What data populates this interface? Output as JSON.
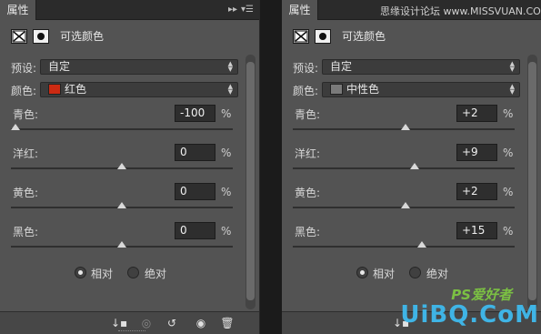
{
  "watermark": "思缘设计论坛 www.MISSVUAN.COM",
  "logo": {
    "line1": "PS爱好者",
    "line2": "UiBQ.CoM"
  },
  "panels": [
    {
      "tab": "属性",
      "title": "可选颜色",
      "preset_label": "预设:",
      "preset_value": "自定",
      "color_label": "颜色:",
      "color_value": "红色",
      "color_swatch": "#cc2a12",
      "sliders": [
        {
          "label": "青色:",
          "value": "-100",
          "unit": "%",
          "position": -100
        },
        {
          "label": "洋红:",
          "value": "0",
          "unit": "%",
          "position": 0
        },
        {
          "label": "黄色:",
          "value": "0",
          "unit": "%",
          "position": 0
        },
        {
          "label": "黑色:",
          "value": "0",
          "unit": "%",
          "position": 0
        }
      ],
      "radio_relative": "相对",
      "radio_absolute": "绝对",
      "selected_mode": "relative"
    },
    {
      "tab": "属性",
      "title": "可选颜色",
      "preset_label": "预设:",
      "preset_value": "自定",
      "color_label": "颜色:",
      "color_value": "中性色",
      "color_swatch": "#7a7a7a",
      "sliders": [
        {
          "label": "青色:",
          "value": "+2",
          "unit": "%",
          "position": 2
        },
        {
          "label": "洋红:",
          "value": "+9",
          "unit": "%",
          "position": 9
        },
        {
          "label": "黄色:",
          "value": "+2",
          "unit": "%",
          "position": 2
        },
        {
          "label": "黑色:",
          "value": "+15",
          "unit": "%",
          "position": 15
        }
      ],
      "radio_relative": "相对",
      "radio_absolute": "绝对",
      "selected_mode": "relative"
    }
  ]
}
